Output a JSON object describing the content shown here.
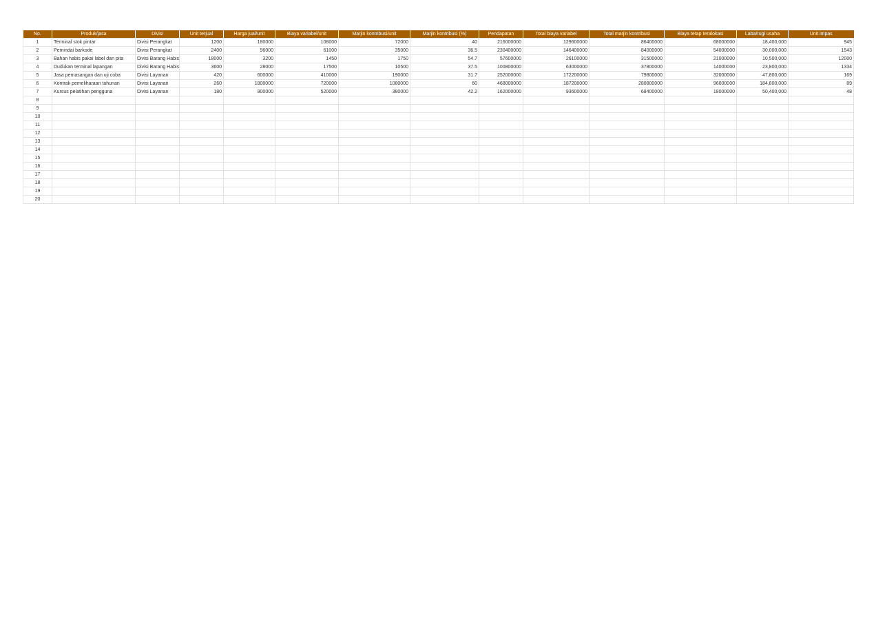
{
  "sheet": {
    "columns": [
      {
        "key": "no",
        "label": "No."
      },
      {
        "key": "produk",
        "label": "Produk/jasa"
      },
      {
        "key": "divisi",
        "label": "Divisi"
      },
      {
        "key": "unit_terjual",
        "label": "Unit terjual"
      },
      {
        "key": "harga",
        "label": "Harga jual/unit"
      },
      {
        "key": "biaya_var",
        "label": "Biaya variabel/unit"
      },
      {
        "key": "marjin_unit",
        "label": "Marjin kontribusi/unit"
      },
      {
        "key": "marjin_pct",
        "label": "Marjin kontribusi (%)"
      },
      {
        "key": "pendapatan",
        "label": "Pendapatan"
      },
      {
        "key": "total_biaya_var",
        "label": "Total biaya variabel"
      },
      {
        "key": "total_marjin",
        "label": "Total marjin kontribusi"
      },
      {
        "key": "biaya_tetap",
        "label": "Biaya tetap teralokasi"
      },
      {
        "key": "laba",
        "label": "Laba/rugi usaha"
      },
      {
        "key": "unit_impas",
        "label": "Unit impas"
      }
    ],
    "rows": [
      [
        "1",
        "Terminal stok pintar",
        "Divisi Perangkat",
        "1200",
        "180000",
        "108000",
        "72000",
        "40",
        "216000000",
        "129600000",
        "86400000",
        "68000000",
        "18,400,000",
        "945"
      ],
      [
        "2",
        "Pemindai barkode",
        "Divisi Perangkat",
        "2400",
        "96000",
        "61000",
        "35000",
        "36.5",
        "230400000",
        "146400000",
        "84000000",
        "54000000",
        "30,000,000",
        "1543"
      ],
      [
        "3",
        "Bahan habis pakai label dan pita",
        "Divisi Barang Habis P",
        "18000",
        "3200",
        "1450",
        "1750",
        "54.7",
        "57600000",
        "26100000",
        "31500000",
        "21000000",
        "10,500,000",
        "12000"
      ],
      [
        "4",
        "Dudukan terminal lapangan",
        "Divisi Barang Habis P",
        "3600",
        "28000",
        "17500",
        "10500",
        "37.5",
        "100800000",
        "63000000",
        "37800000",
        "14000000",
        "23,800,000",
        "1334"
      ],
      [
        "5",
        "Jasa pemasangan dan uji coba",
        "Divisi Layanan",
        "420",
        "600000",
        "410000",
        "190000",
        "31.7",
        "252000000",
        "172200000",
        "79800000",
        "32000000",
        "47,800,000",
        "169"
      ],
      [
        "6",
        "Kontrak pemeliharaan tahunan",
        "Divisi Layanan",
        "260",
        "1800000",
        "720000",
        "1080000",
        "60",
        "468000000",
        "187200000",
        "280800000",
        "96000000",
        "184,800,000",
        "89"
      ],
      [
        "7",
        "Kursus pelatihan pengguna",
        "Divisi Layanan",
        "180",
        "900000",
        "520000",
        "380000",
        "42.2",
        "162000000",
        "93600000",
        "68400000",
        "18000000",
        "50,400,000",
        "48"
      ],
      [
        "8",
        "",
        "",
        "",
        "",
        "",
        "",
        "",
        "",
        "",
        "",
        "",
        "",
        ""
      ],
      [
        "9",
        "",
        "",
        "",
        "",
        "",
        "",
        "",
        "",
        "",
        "",
        "",
        "",
        ""
      ],
      [
        "10",
        "",
        "",
        "",
        "",
        "",
        "",
        "",
        "",
        "",
        "",
        "",
        "",
        ""
      ],
      [
        "11",
        "",
        "",
        "",
        "",
        "",
        "",
        "",
        "",
        "",
        "",
        "",
        "",
        ""
      ],
      [
        "12",
        "",
        "",
        "",
        "",
        "",
        "",
        "",
        "",
        "",
        "",
        "",
        "",
        ""
      ],
      [
        "13",
        "",
        "",
        "",
        "",
        "",
        "",
        "",
        "",
        "",
        "",
        "",
        "",
        ""
      ],
      [
        "14",
        "",
        "",
        "",
        "",
        "",
        "",
        "",
        "",
        "",
        "",
        "",
        "",
        ""
      ],
      [
        "15",
        "",
        "",
        "",
        "",
        "",
        "",
        "",
        "",
        "",
        "",
        "",
        "",
        ""
      ],
      [
        "16",
        "",
        "",
        "",
        "",
        "",
        "",
        "",
        "",
        "",
        "",
        "",
        "",
        ""
      ],
      [
        "17",
        "",
        "",
        "",
        "",
        "",
        "",
        "",
        "",
        "",
        "",
        "",
        "",
        ""
      ],
      [
        "18",
        "",
        "",
        "",
        "",
        "",
        "",
        "",
        "",
        "",
        "",
        "",
        "",
        ""
      ],
      [
        "19",
        "",
        "",
        "",
        "",
        "",
        "",
        "",
        "",
        "",
        "",
        "",
        "",
        ""
      ],
      [
        "20",
        "",
        "",
        "",
        "",
        "",
        "",
        "",
        "",
        "",
        "",
        "",
        "",
        ""
      ]
    ]
  },
  "colors": {
    "header_bg": "#a65f00",
    "header_text": "#ffffff",
    "grid": "#e2e2e2"
  }
}
